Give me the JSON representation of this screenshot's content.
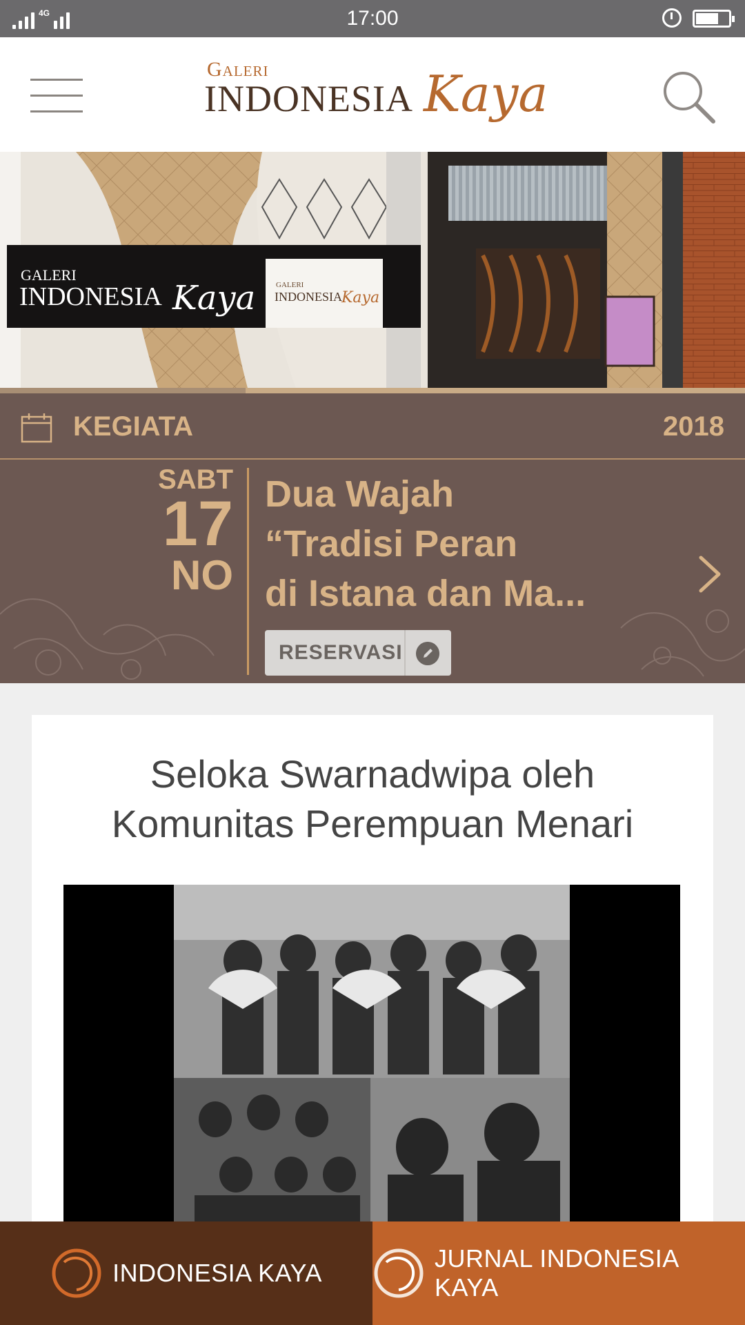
{
  "status_bar": {
    "network": "4G",
    "time": "17:00",
    "battery_level": 0.7
  },
  "header": {
    "logo_line_small": "Galeri",
    "logo_line_main": "INDONESIA",
    "logo_script": "Kaya"
  },
  "hero": {
    "sign_small": "Galeri",
    "sign_main": "INDONESIA",
    "sign_script": "Kaya",
    "slide_progress": 0.33
  },
  "events": {
    "title": "KEGIATA",
    "year": "2018",
    "date_dow": "SABT",
    "date_day": "17",
    "date_month": "NO",
    "event_title_lines": [
      "Dua Wajah",
      "“Tradisi Peran",
      "di Istana dan Ma..."
    ],
    "reserve_label": "RESERVASI"
  },
  "article": {
    "title_line1": "Seloka Swarnadwipa oleh",
    "title_line2": "Komunitas Perempuan Menari"
  },
  "bottom_nav": {
    "tab1_label": "INDONESIA KAYA",
    "tab2_label": "JURNAL INDONESIA KAYA"
  },
  "colors": {
    "status_bar": "#6b6a6c",
    "events_bg": "#6c5852",
    "gold_text": "#d8b387",
    "tab_dark": "#562f18",
    "tab_orange": "#c0632a",
    "brand_orange": "#b6692f"
  }
}
